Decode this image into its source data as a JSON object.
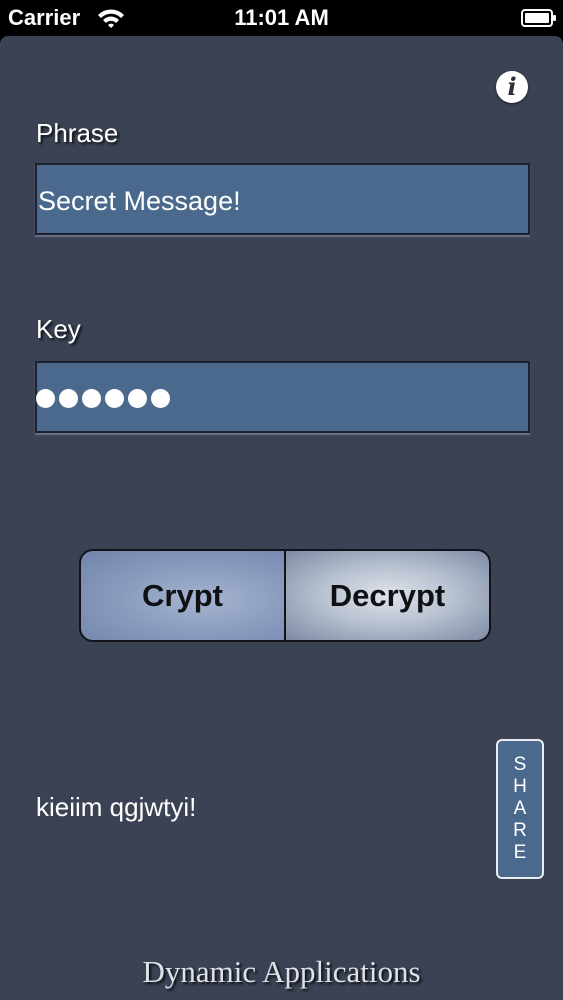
{
  "status_bar": {
    "carrier": "Carrier",
    "time": "11:01 AM",
    "wifi_icon": "wifi-icon",
    "battery_icon": "battery-icon"
  },
  "colors": {
    "background": "#3a4253",
    "field_fill": "#4b698c",
    "text": "#ffffff"
  },
  "info_button": {
    "icon": "info-icon",
    "glyph": "i"
  },
  "phrase": {
    "label": "Phrase",
    "value": "Secret Message!"
  },
  "key": {
    "label": "Key",
    "masked_length": 6
  },
  "mode_selector": {
    "crypt_label": "Crypt",
    "decrypt_label": "Decrypt",
    "selected": "Crypt"
  },
  "result": {
    "text": "kieiim qgjwtyi!"
  },
  "share_button": {
    "label": "SHARE"
  },
  "footer": {
    "brand": "Dynamic Applications"
  }
}
